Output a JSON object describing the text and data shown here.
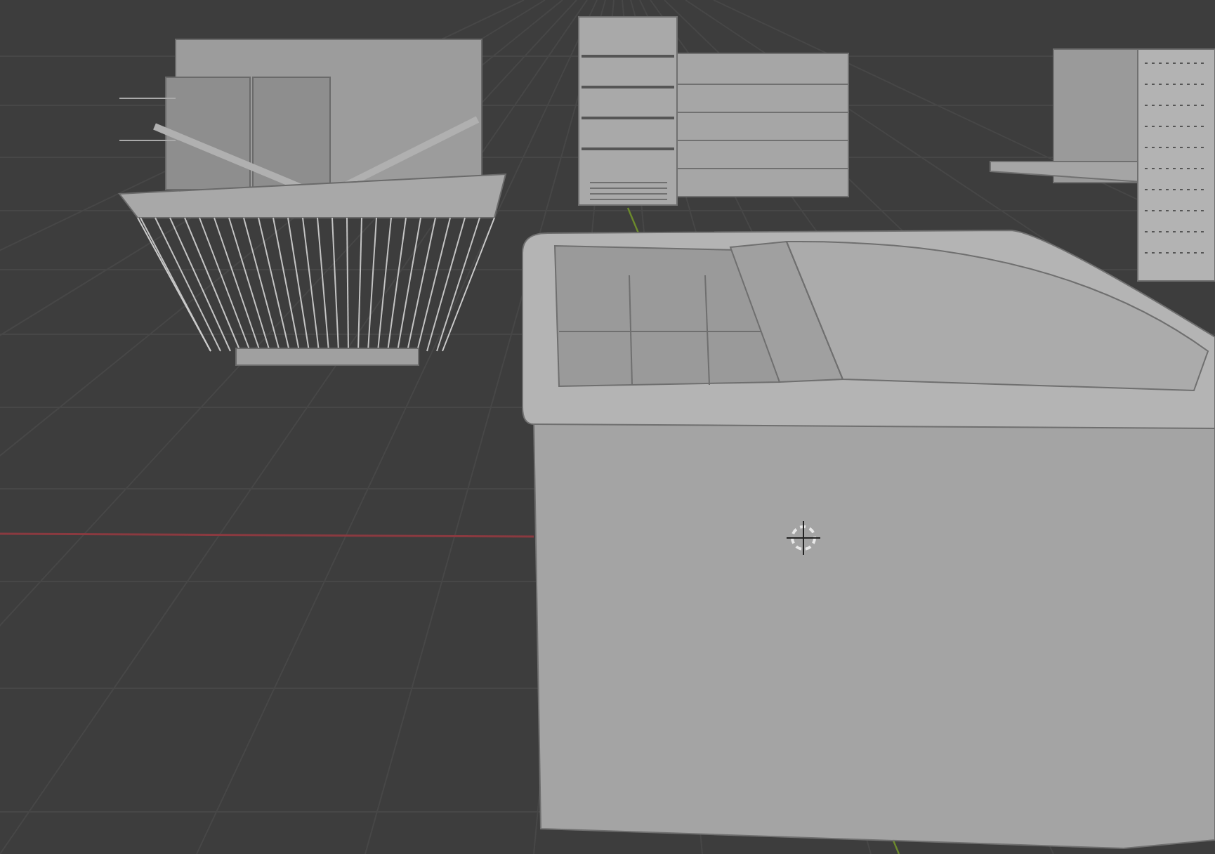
{
  "viewport": {
    "objects": [
      {
        "kind": "basket"
      },
      {
        "kind": "shelf"
      },
      {
        "kind": "rack"
      },
      {
        "kind": "freezer"
      }
    ]
  }
}
